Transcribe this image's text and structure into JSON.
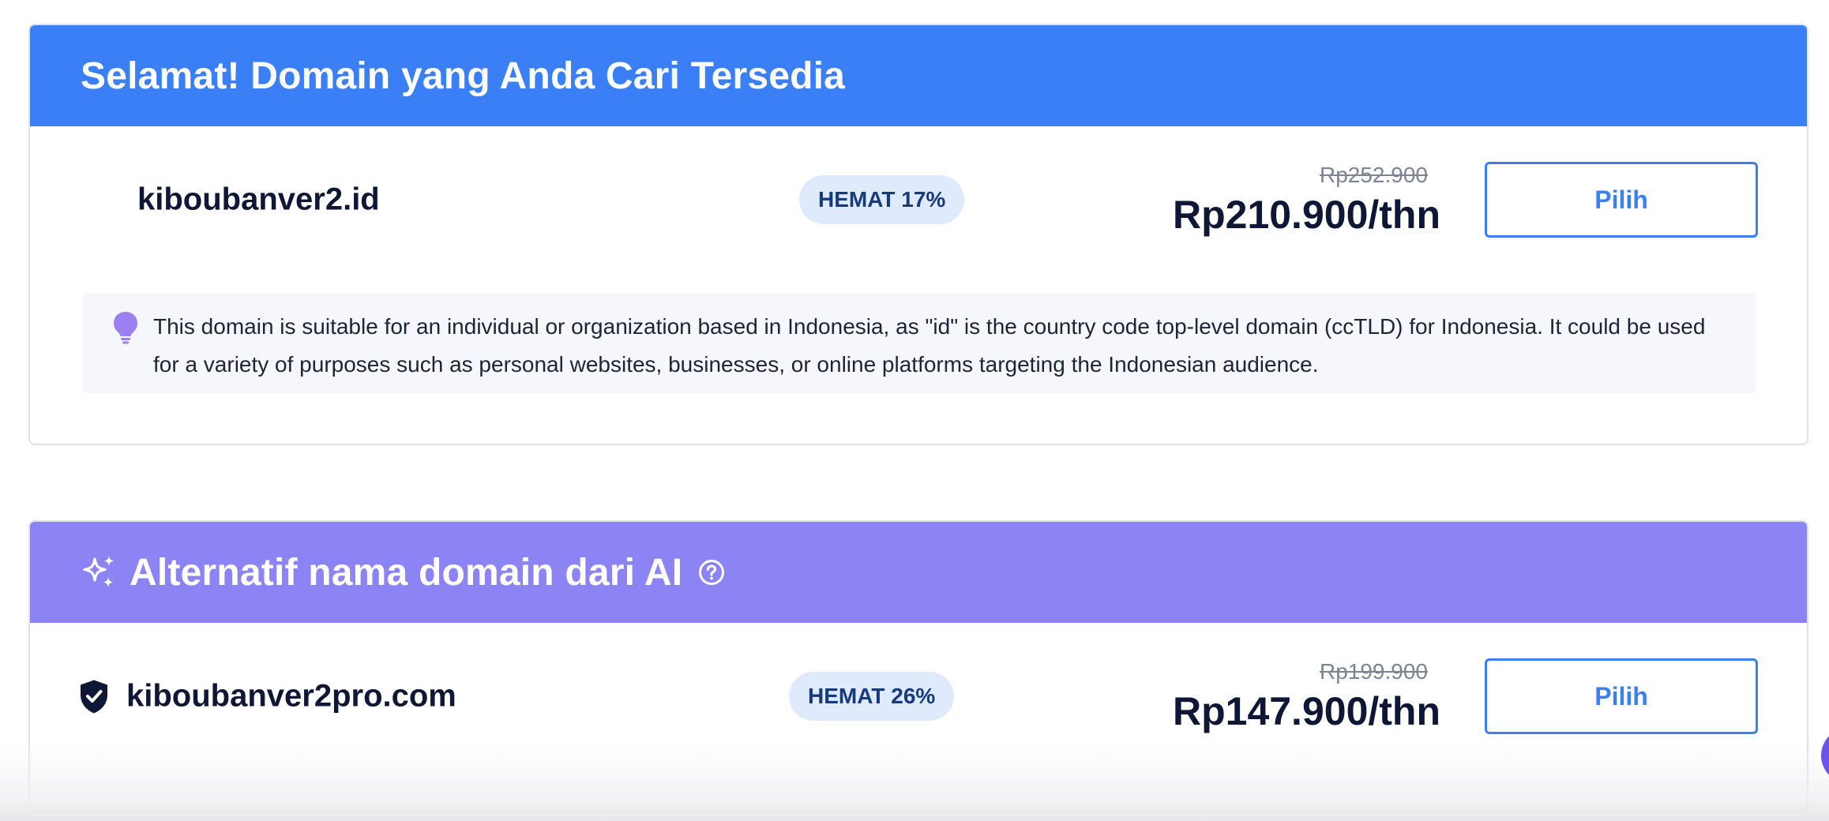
{
  "available": {
    "header_title": "Selamat! Domain yang Anda Cari Tersedia",
    "domain": "kiboubanver2.id",
    "badge": "HEMAT 17%",
    "price_old": "Rp252.900",
    "price_new": "Rp210.900/thn",
    "button_label": "Pilih",
    "suggestion_text": "This domain is suitable for an individual or organization based in Indonesia, as \"id\" is the country code top-level domain (ccTLD) for Indonesia. It could be used for a variety of purposes such as personal websites, businesses, or online platforms targeting the Indonesian audience.",
    "suggestion_icon": "lightbulb-icon"
  },
  "ai_alternatives": {
    "header_title": "Alternatif nama domain dari AI",
    "header_icon": "sparkle-icon",
    "help_icon": "help-icon",
    "items": [
      {
        "domain": "kiboubanver2pro.com",
        "icon": "shield-check-icon",
        "badge": "HEMAT 26%",
        "price_old": "Rp199.900",
        "price_new": "Rp147.900/thn",
        "button_label": "Pilih"
      }
    ]
  },
  "colors": {
    "primary_blue": "#3a7ff5",
    "ai_purple": "#8c84f5",
    "badge_bg": "#dfeafd",
    "text_dark": "#0e1735",
    "bulb_purple": "#9b80f2"
  }
}
